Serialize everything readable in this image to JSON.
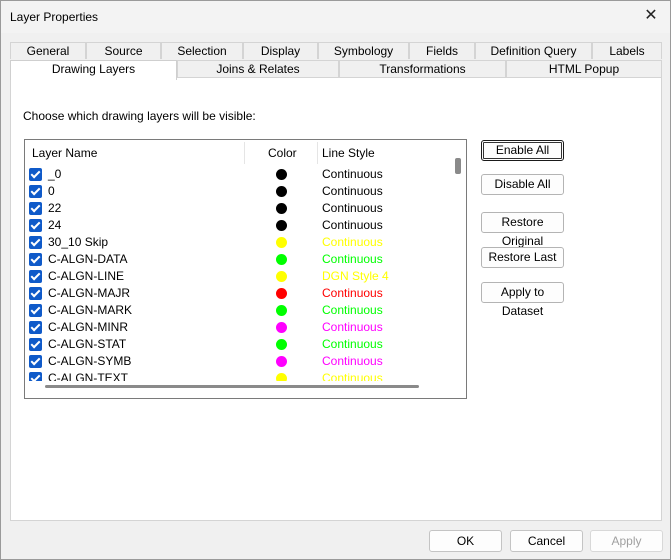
{
  "window": {
    "title": "Layer Properties"
  },
  "tabs_row1": [
    "General",
    "Source",
    "Selection",
    "Display",
    "Symbology",
    "Fields",
    "Definition Query",
    "Labels"
  ],
  "tabs_row2": [
    "Drawing Layers",
    "Joins & Relates",
    "Transformations",
    "HTML Popup"
  ],
  "active_tab": "Drawing Layers",
  "instruction": "Choose which drawing layers will be visible:",
  "columns": {
    "name": "Layer Name",
    "color": "Color",
    "style": "Line Style"
  },
  "layers": [
    {
      "name": "_0",
      "checked": true,
      "color": "#000000",
      "style": "Continuous",
      "style_color": "#000000"
    },
    {
      "name": "0",
      "checked": true,
      "color": "#000000",
      "style": "Continuous",
      "style_color": "#000000"
    },
    {
      "name": "22",
      "checked": true,
      "color": "#000000",
      "style": "Continuous",
      "style_color": "#000000"
    },
    {
      "name": "24",
      "checked": true,
      "color": "#000000",
      "style": "Continuous",
      "style_color": "#000000"
    },
    {
      "name": "30_10 Skip",
      "checked": true,
      "color": "#ffff00",
      "style": "Continuous",
      "style_color": "#ffff00"
    },
    {
      "name": "C-ALGN-DATA",
      "checked": true,
      "color": "#00ff00",
      "style": "Continuous",
      "style_color": "#00ff00"
    },
    {
      "name": "C-ALGN-LINE",
      "checked": true,
      "color": "#ffff00",
      "style": "DGN Style 4",
      "style_color": "#ffff00"
    },
    {
      "name": "C-ALGN-MAJR",
      "checked": true,
      "color": "#ff0000",
      "style": "Continuous",
      "style_color": "#ff0000"
    },
    {
      "name": "C-ALGN-MARK",
      "checked": true,
      "color": "#00ff00",
      "style": "Continuous",
      "style_color": "#00ff00"
    },
    {
      "name": "C-ALGN-MINR",
      "checked": true,
      "color": "#ff00ff",
      "style": "Continuous",
      "style_color": "#ff00ff"
    },
    {
      "name": "C-ALGN-STAT",
      "checked": true,
      "color": "#00ff00",
      "style": "Continuous",
      "style_color": "#00ff00"
    },
    {
      "name": "C-ALGN-SYMB",
      "checked": true,
      "color": "#ff00ff",
      "style": "Continuous",
      "style_color": "#ff00ff"
    },
    {
      "name": "C-ALGN-TEXT",
      "checked": true,
      "color": "#ffff00",
      "style": "Continuous",
      "style_color": "#ffff00"
    }
  ],
  "side_buttons": {
    "enable_all": "Enable All",
    "disable_all": "Disable All",
    "restore_original": "Restore Original",
    "restore_last": "Restore Last",
    "apply_to_dataset": "Apply to Dataset"
  },
  "footer": {
    "ok": "OK",
    "cancel": "Cancel",
    "apply": "Apply"
  }
}
